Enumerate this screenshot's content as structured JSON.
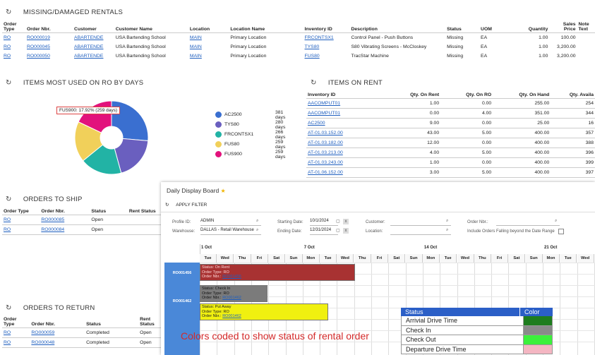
{
  "missing": {
    "title": "MISSING/DAMAGED RENTALS",
    "headers": [
      "Order Type",
      "Order Nbr.",
      "Customer",
      "Customer Name",
      "Location",
      "Location Name",
      "Inventory ID",
      "Description",
      "Status",
      "UOM",
      "Quantity",
      "Sales Price",
      "Note Text"
    ],
    "rows": [
      [
        "RO",
        "RO000019",
        "ABARTENDE",
        "USA Bartending School",
        "MAIN",
        "Primary Location",
        "FRCONTSX1",
        "Control Panel - Push Buttons",
        "Missing",
        "EA",
        "1.00",
        "100.00",
        ""
      ],
      [
        "RO",
        "RO000045",
        "ABARTENDE",
        "USA Bartending School",
        "MAIN",
        "Primary Location",
        "TYS80",
        "S80 Vibrating Screens - McCloskey",
        "Missing",
        "EA",
        "1.00",
        "3,200.00",
        ""
      ],
      [
        "RO",
        "RO000050",
        "ABARTENDE",
        "USA Bartending School",
        "MAIN",
        "Primary Location",
        "FUS80",
        "TracStar Machine",
        "Missing",
        "EA",
        "1.00",
        "3,200.00",
        ""
      ]
    ]
  },
  "most_used": {
    "title": "ITEMS MOST USED ON RO BY DAYS",
    "tooltip": "FUS900: 17.92% (259 days)",
    "items": [
      {
        "name": "AC2500",
        "days": "381 days",
        "color": "#3a6fd0"
      },
      {
        "name": "TYS80",
        "days": "280 days",
        "color": "#6a5fbf"
      },
      {
        "name": "FRCONTSX1",
        "days": "266 days",
        "color": "#22b3a5"
      },
      {
        "name": "FUS80",
        "days": "259 days",
        "color": "#f1d05a"
      },
      {
        "name": "FUS900",
        "days": "259 days",
        "color": "#e2127c"
      }
    ]
  },
  "chart_data": {
    "type": "pie",
    "categories": [
      "AC2500",
      "TYS80",
      "FRCONTSX1",
      "FUS80",
      "FUS900"
    ],
    "values": [
      381,
      280,
      266,
      259,
      259
    ],
    "title": "",
    "hole": true
  },
  "on_rent": {
    "title": "ITEMS ON RENT",
    "headers": [
      "Inventory ID",
      "Qty. On Rent",
      "Qty. On RO",
      "Qty. On Hand",
      "Qty. Availa"
    ],
    "rows": [
      [
        "AACOMPUT01",
        "1.00",
        "0.00",
        "255.00",
        "254"
      ],
      [
        "AACOMPUT01",
        "0.00",
        "4.00",
        "351.00",
        "344"
      ],
      [
        "AC2500",
        "9.00",
        "0.00",
        "25.00",
        "16"
      ],
      [
        "AT-01.03.152.00",
        "43.00",
        "5.00",
        "400.00",
        "357"
      ],
      [
        "AT-01.03.182.00",
        "12.00",
        "0.00",
        "400.00",
        "388"
      ],
      [
        "AT-01.03.213.00",
        "4.00",
        "5.00",
        "400.00",
        "396"
      ],
      [
        "AT-01.03.243.00",
        "1.00",
        "0.00",
        "400.00",
        "399"
      ],
      [
        "AT-01.06.152.00",
        "3.00",
        "5.00",
        "400.00",
        "397"
      ]
    ]
  },
  "ship": {
    "title": "ORDERS TO SHIP",
    "headers": [
      "Order Type",
      "Order Nbr.",
      "Status",
      "Rent Status"
    ],
    "rows": [
      [
        "RO",
        "RO000085",
        "Open"
      ],
      [
        "RO",
        "RO000084",
        "Open"
      ]
    ]
  },
  "ret": {
    "title": "ORDERS TO RETURN",
    "headers": [
      "Order Type",
      "Order Nbr.",
      "Status",
      "Rent Status"
    ],
    "rows": [
      [
        "RO",
        "RO000059",
        "Completed",
        "Open"
      ],
      [
        "RO",
        "RO000048",
        "Completed",
        "Open"
      ]
    ]
  },
  "board": {
    "title": "Daily Display Board",
    "star": "★",
    "apply": "APPLY FILTER",
    "profile_label": "Profile ID:",
    "profile_value": "ADMIN",
    "warehouse_label": "Warehouse:",
    "warehouse_value": "DALLAS - Retail Warehouse",
    "start_label": "Starting Date:",
    "start_value": "10/1/2024",
    "end_label": "Ending Date:",
    "end_value": "12/31/2024",
    "customer_label": "Customer:",
    "location_label": "Location:",
    "order_label": "Order Nbr.:",
    "include_label": "Include Orders Falling beyond the Date Range",
    "weeks": [
      "1 Oct",
      "7 Oct",
      "14 Oct",
      "21 Oct"
    ],
    "days": [
      "Tue",
      "Wed",
      "Thu",
      "Fri",
      "Sat",
      "Sun",
      "Mon",
      "Tue",
      "Wed",
      "Thu",
      "Fri",
      "Sat",
      "Sun",
      "Mon",
      "Tue",
      "Wed",
      "Thu",
      "Fri",
      "Sat",
      "Sun",
      "Mon",
      "Tue",
      "Wed"
    ],
    "orders": [
      {
        "id": "RO001456",
        "lines": [
          "Status: On Rent",
          "Order Type: RO",
          "Order Nbr.:"
        ],
        "link": "RO001456",
        "color": "#a83232",
        "text": "#ffd6d6"
      },
      {
        "id": "RO001462",
        "lines": [
          "Status: Check In",
          "Order Type: RO",
          "Order Nbr.:"
        ],
        "link": "RO001462",
        "color": "#7b7b7b",
        "text": "#111"
      },
      {
        "id": "",
        "lines": [
          "Status: Put Away",
          "Order Type: RO",
          "Order Nbr.:"
        ],
        "link": "RO001462",
        "color": "#f0f010",
        "text": "#222"
      }
    ],
    "status_table": {
      "header_status": "Status",
      "header_color": "Color",
      "rows": [
        {
          "label": "Arrivial Drive Time",
          "color": "#1e7d1e"
        },
        {
          "label": "Check In",
          "color": "#8a8a8a"
        },
        {
          "label": "Check Out",
          "color": "#3cf03c"
        },
        {
          "label": "Departure Drive Time",
          "color": "#f4b6c2"
        }
      ]
    },
    "caption": "Colors coded to show status of rental order"
  }
}
